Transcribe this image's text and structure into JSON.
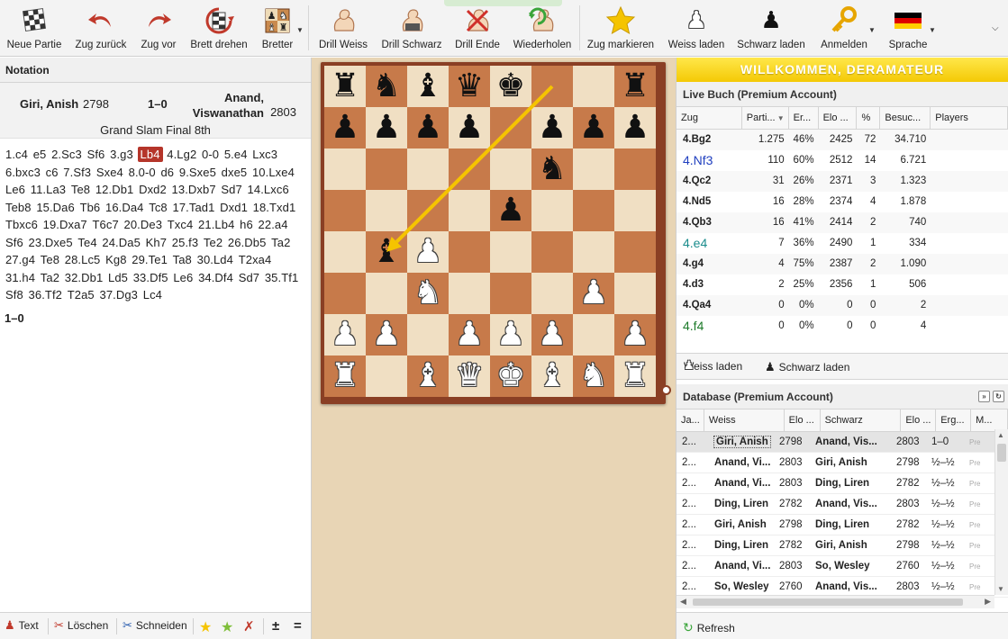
{
  "toolbar": {
    "items": [
      {
        "label": "Neue Partie",
        "icon": "new-game-icon"
      },
      {
        "label": "Zug zurück",
        "icon": "undo-arrow-icon"
      },
      {
        "label": "Zug vor",
        "icon": "redo-arrow-icon"
      },
      {
        "label": "Brett drehen",
        "icon": "rotate-board-icon"
      },
      {
        "label": "Bretter",
        "icon": "boards-icon"
      },
      {
        "label": "Drill Weiss",
        "icon": "drill-white-arm-icon"
      },
      {
        "label": "Drill Schwarz",
        "icon": "drill-black-arm-icon"
      },
      {
        "label": "Drill Ende",
        "icon": "drill-end-arm-icon"
      },
      {
        "label": "Wiederholen",
        "icon": "repeat-arm-icon"
      },
      {
        "label": "Zug markieren",
        "icon": "star-icon"
      },
      {
        "label": "Weiss laden",
        "icon": "white-pawn-icon"
      },
      {
        "label": "Schwarz laden",
        "icon": "black-pawn-icon"
      },
      {
        "label": "Anmelden",
        "icon": "key-icon"
      },
      {
        "label": "Sprache",
        "icon": "german-flag-icon"
      }
    ],
    "colors": {
      "arrow": "#c0392b",
      "star": "#f5c400",
      "flag_black": "#000000",
      "flag_red": "#dd0000",
      "flag_gold": "#ffce00"
    }
  },
  "notation": {
    "title": "Notation",
    "white_player": "Giri, Anish",
    "white_elo": "2798",
    "result": "1–0",
    "black_player": "Anand, Viswanathan",
    "black_elo": "2803",
    "event": "Grand Slam Final 8th",
    "moves": [
      "1.c4",
      "e5",
      "2.Sc3",
      "Sf6",
      "3.g3",
      "Lb4",
      "4.Lg2",
      "0-0",
      "5.e4",
      "Lxc3",
      "6.bxc3",
      "c6",
      "7.Sf3",
      "Sxe4",
      "8.0-0",
      "d6",
      "9.Sxe5",
      "dxe5",
      "10.Lxe4",
      "Le6",
      "11.La3",
      "Te8",
      "12.Db1",
      "Dxd2",
      "13.Dxb7",
      "Sd7",
      "14.Lxc6",
      "Teb8",
      "15.Da6",
      "Tb6",
      "16.Da4",
      "Tc8",
      "17.Tad1",
      "Dxd1",
      "18.Txd1",
      "Tbxc6",
      "19.Dxa7",
      "T6c7",
      "20.De3",
      "Txc4",
      "21.Lb4",
      "h6",
      "22.a4",
      "Sf6",
      "23.Dxe5",
      "Te4",
      "24.Da5",
      "Kh7",
      "25.f3",
      "Te2",
      "26.Db5",
      "Ta2",
      "27.g4",
      "Te8",
      "28.Lc5",
      "Kg8",
      "29.Te1",
      "Ta8",
      "30.Ld4",
      "T2xa4",
      "31.h4",
      "Ta2",
      "32.Db1",
      "Ld5",
      "33.Df5",
      "Le6",
      "34.Df4",
      "Sd7",
      "35.Tf1",
      "Sf8",
      "36.Tf2",
      "T2a5",
      "37.Dg3",
      "Lc4"
    ],
    "current_move_index": 5,
    "final_result": "1–0",
    "footer": {
      "text": "Text",
      "delete": "Löschen",
      "cut": "Schneiden",
      "plusminus": "±",
      "equal": "="
    }
  },
  "board": {
    "pieces": [
      {
        "sq": "a8",
        "piece": "r"
      },
      {
        "sq": "b8",
        "piece": "n"
      },
      {
        "sq": "c8",
        "piece": "b"
      },
      {
        "sq": "d8",
        "piece": "q"
      },
      {
        "sq": "e8",
        "piece": "k"
      },
      {
        "sq": "h8",
        "piece": "r"
      },
      {
        "sq": "a7",
        "piece": "p"
      },
      {
        "sq": "b7",
        "piece": "p"
      },
      {
        "sq": "c7",
        "piece": "p"
      },
      {
        "sq": "d7",
        "piece": "p"
      },
      {
        "sq": "f7",
        "piece": "p"
      },
      {
        "sq": "g7",
        "piece": "p"
      },
      {
        "sq": "h7",
        "piece": "p"
      },
      {
        "sq": "f6",
        "piece": "n"
      },
      {
        "sq": "e5",
        "piece": "p"
      },
      {
        "sq": "b4",
        "piece": "b"
      },
      {
        "sq": "c4",
        "piece": "P"
      },
      {
        "sq": "c3",
        "piece": "N"
      },
      {
        "sq": "g3",
        "piece": "P"
      },
      {
        "sq": "a2",
        "piece": "P"
      },
      {
        "sq": "b2",
        "piece": "P"
      },
      {
        "sq": "d2",
        "piece": "P"
      },
      {
        "sq": "e2",
        "piece": "P"
      },
      {
        "sq": "f2",
        "piece": "P"
      },
      {
        "sq": "h2",
        "piece": "P"
      },
      {
        "sq": "a1",
        "piece": "R"
      },
      {
        "sq": "c1",
        "piece": "B"
      },
      {
        "sq": "d1",
        "piece": "Q"
      },
      {
        "sq": "e1",
        "piece": "K"
      },
      {
        "sq": "f1",
        "piece": "B"
      },
      {
        "sq": "g1",
        "piece": "N"
      },
      {
        "sq": "h1",
        "piece": "R"
      }
    ],
    "arrow": {
      "from": "f8",
      "to": "b4",
      "color": "#f5c400"
    },
    "colors": {
      "light": "#f0dfc3",
      "dark": "#c77a4a",
      "frame": "#8a3f24"
    }
  },
  "welcome": "WILLKOMMEN, DERAMATEUR",
  "live_book": {
    "title": "Live Buch (Premium Account)",
    "columns": [
      "Zug",
      "Parti...",
      "Er...",
      "Elo ...",
      "%",
      "Besuc...",
      "Players"
    ],
    "rows": [
      {
        "move": "4.Bg2",
        "games": "1.275",
        "score": "46%",
        "elo": "2425",
        "pct": "72",
        "visits": "34.710",
        "color": "#222222",
        "big": false
      },
      {
        "move": "4.Nf3",
        "games": "110",
        "score": "60%",
        "elo": "2512",
        "pct": "14",
        "visits": "6.721",
        "color": "#1f3fbf",
        "big": true
      },
      {
        "move": "4.Qc2",
        "games": "31",
        "score": "26%",
        "elo": "2371",
        "pct": "3",
        "visits": "1.323",
        "color": "#222222",
        "big": false
      },
      {
        "move": "4.Nd5",
        "games": "16",
        "score": "28%",
        "elo": "2374",
        "pct": "4",
        "visits": "1.878",
        "color": "#222222",
        "big": false
      },
      {
        "move": "4.Qb3",
        "games": "16",
        "score": "41%",
        "elo": "2414",
        "pct": "2",
        "visits": "740",
        "color": "#222222",
        "big": false
      },
      {
        "move": "4.e4",
        "games": "7",
        "score": "36%",
        "elo": "2490",
        "pct": "1",
        "visits": "334",
        "color": "#1a8c8c",
        "big": true
      },
      {
        "move": "4.g4",
        "games": "4",
        "score": "75%",
        "elo": "2387",
        "pct": "2",
        "visits": "1.090",
        "color": "#222222",
        "big": false
      },
      {
        "move": "4.d3",
        "games": "2",
        "score": "25%",
        "elo": "2356",
        "pct": "1",
        "visits": "506",
        "color": "#222222",
        "big": false
      },
      {
        "move": "4.Qa4",
        "games": "0",
        "score": "0%",
        "elo": "0",
        "pct": "0",
        "visits": "2",
        "color": "#222222",
        "big": false
      },
      {
        "move": "4.f4",
        "games": "0",
        "score": "0%",
        "elo": "0",
        "pct": "0",
        "visits": "4",
        "color": "#1d7a2a",
        "big": true
      }
    ],
    "footer": {
      "load_white": "Weiss laden",
      "load_black": "Schwarz laden"
    }
  },
  "database": {
    "title": "Database (Premium Account)",
    "columns": [
      "Ja...",
      "Weiss",
      "Elo ...",
      "Schwarz",
      "Elo ...",
      "Erg...",
      "M..."
    ],
    "rows": [
      {
        "year": "2...",
        "white": "Giri, Anish",
        "welo": "2798",
        "black": "Anand, Vis...",
        "belo": "2803",
        "res": "1–0",
        "m": "Pre"
      },
      {
        "year": "2...",
        "white": "Anand, Vi...",
        "welo": "2803",
        "black": "Giri, Anish",
        "belo": "2798",
        "res": "½–½",
        "m": "Pre"
      },
      {
        "year": "2...",
        "white": "Anand, Vi...",
        "welo": "2803",
        "black": "Ding, Liren",
        "belo": "2782",
        "res": "½–½",
        "m": "Pre"
      },
      {
        "year": "2...",
        "white": "Ding, Liren",
        "welo": "2782",
        "black": "Anand, Vis...",
        "belo": "2803",
        "res": "½–½",
        "m": "Pre"
      },
      {
        "year": "2...",
        "white": "Giri, Anish",
        "welo": "2798",
        "black": "Ding, Liren",
        "belo": "2782",
        "res": "½–½",
        "m": "Pre"
      },
      {
        "year": "2...",
        "white": "Ding, Liren",
        "welo": "2782",
        "black": "Giri, Anish",
        "belo": "2798",
        "res": "½–½",
        "m": "Pre"
      },
      {
        "year": "2...",
        "white": "Anand, Vi...",
        "welo": "2803",
        "black": "So, Wesley",
        "belo": "2760",
        "res": "½–½",
        "m": "Pre"
      },
      {
        "year": "2...",
        "white": "So, Wesley",
        "welo": "2760",
        "black": "Anand, Vis...",
        "belo": "2803",
        "res": "½–½",
        "m": "Pre"
      }
    ],
    "refresh": "Refresh"
  }
}
